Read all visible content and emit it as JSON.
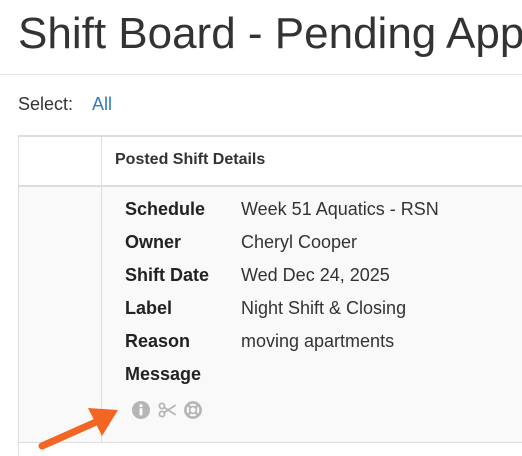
{
  "page": {
    "title": "Shift Board - Pending Approvals"
  },
  "select": {
    "label": "Select:",
    "all_link": "All"
  },
  "table": {
    "header": {
      "details_label": "Posted Shift Details"
    },
    "rows": [
      {
        "fields": [
          {
            "key": "Schedule",
            "value": "Week 51 Aquatics - RSN"
          },
          {
            "key": "Owner",
            "value": "Cheryl Cooper"
          },
          {
            "key": "Shift Date",
            "value": "Wed Dec 24, 2025"
          },
          {
            "key": "Label",
            "value": "Night Shift & Closing"
          },
          {
            "key": "Reason",
            "value": "moving apartments"
          },
          {
            "key": "Message",
            "value": ""
          }
        ],
        "actions": [
          "info-icon",
          "scissors-icon",
          "lifebuoy-icon"
        ]
      }
    ]
  },
  "colors": {
    "link": "#337ab7",
    "icon_gray": "#b5b5b5",
    "annotation_arrow": "#f26522",
    "row_bg": "#f9f9f9",
    "border": "#dddddd"
  }
}
